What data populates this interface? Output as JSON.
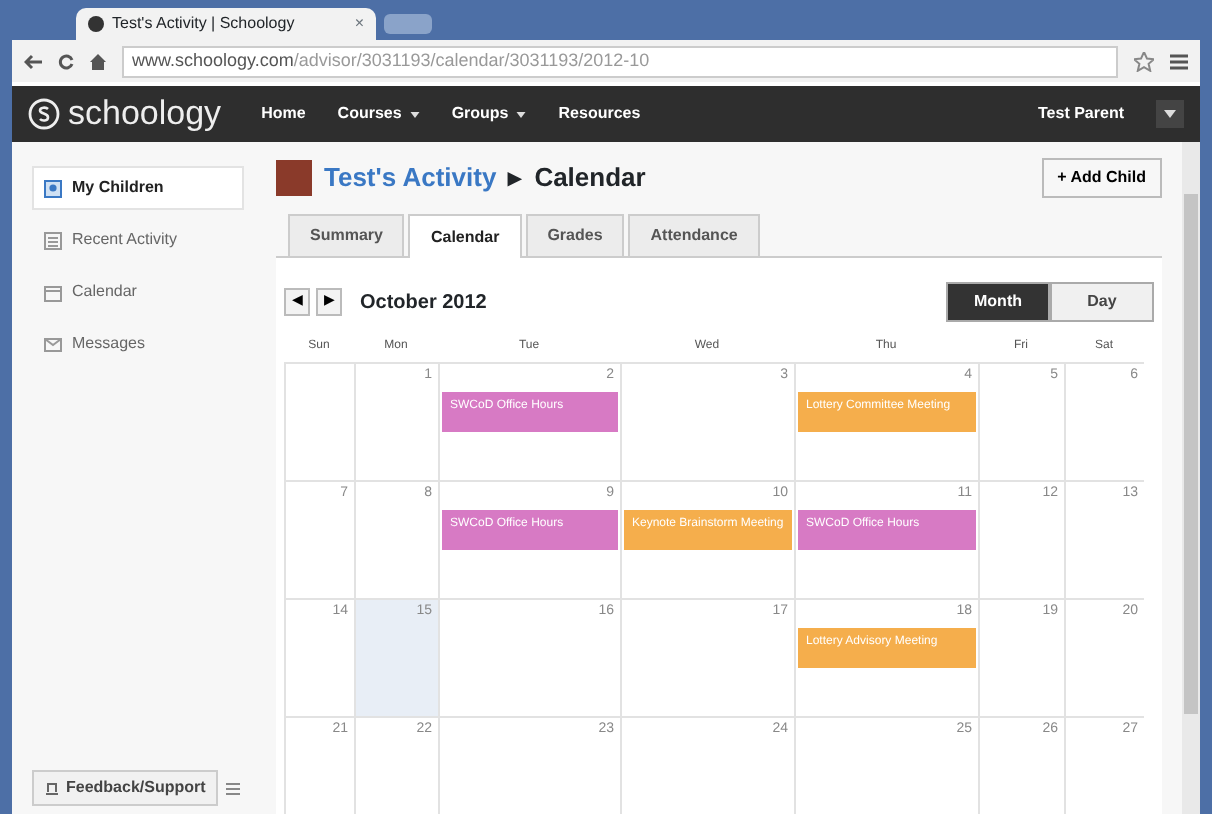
{
  "browser": {
    "tab_title": "Test's Activity | Schoology",
    "tab_close": "×",
    "url_host": "www.schoology.com",
    "url_path": "/advisor/3031193/calendar/3031193/2012-10"
  },
  "navbar": {
    "logo": "schoology",
    "items": [
      {
        "label": "Home",
        "dropdown": false
      },
      {
        "label": "Courses",
        "dropdown": true
      },
      {
        "label": "Groups",
        "dropdown": true
      },
      {
        "label": "Resources",
        "dropdown": false
      }
    ],
    "user": "Test Parent"
  },
  "sidebar": {
    "items": [
      {
        "label": "My Children",
        "selected": true
      },
      {
        "label": "Recent Activity",
        "selected": false
      },
      {
        "label": "Calendar",
        "selected": false
      },
      {
        "label": "Messages",
        "selected": false
      }
    ]
  },
  "header": {
    "link": "Test's Activity",
    "separator": "▸",
    "title": "Calendar",
    "add_button": "+ Add Child"
  },
  "tabs": [
    {
      "label": "Summary",
      "selected": false
    },
    {
      "label": "Calendar",
      "selected": true
    },
    {
      "label": "Grades",
      "selected": false
    },
    {
      "label": "Attendance",
      "selected": false
    }
  ],
  "calendar": {
    "prev": "◀",
    "next": "▶",
    "month": "October 2012",
    "views": [
      {
        "label": "Month",
        "selected": true
      },
      {
        "label": "Day",
        "selected": false
      }
    ],
    "weekdays": [
      "Sun",
      "Mon",
      "Tue",
      "Wed",
      "Thu",
      "Fri",
      "Sat"
    ],
    "weeks": [
      {
        "days": [
          {
            "today": false
          },
          {
            "num": "1",
            "today": false
          },
          {
            "num": "2",
            "today": false,
            "events": [
              {
                "title": "SWCoD Office Hours",
                "color": "#d77ac4"
              }
            ]
          },
          {
            "num": "3",
            "today": false
          },
          {
            "num": "4",
            "today": false,
            "events": [
              {
                "title": "Lottery Committee Meeting",
                "color": "#f5ae4c"
              }
            ]
          },
          {
            "num": "5",
            "today": false
          },
          {
            "num": "6",
            "today": false
          }
        ]
      },
      {
        "days": [
          {
            "num": "7",
            "today": false
          },
          {
            "num": "8",
            "today": false
          },
          {
            "num": "9",
            "today": false,
            "events": [
              {
                "title": "SWCoD Office Hours",
                "color": "#d77ac4"
              }
            ]
          },
          {
            "num": "10",
            "today": false,
            "events": [
              {
                "title": "Keynote Brainstorm Meeting",
                "color": "#f5ae4c"
              }
            ]
          },
          {
            "num": "11",
            "today": false,
            "events": [
              {
                "title": "SWCoD Office Hours",
                "color": "#d77ac4"
              }
            ]
          },
          {
            "num": "12",
            "today": false
          },
          {
            "num": "13",
            "today": false
          }
        ]
      },
      {
        "days": [
          {
            "num": "14",
            "today": false
          },
          {
            "num": "15",
            "today": true
          },
          {
            "num": "16",
            "today": false
          },
          {
            "num": "17",
            "today": false
          },
          {
            "num": "18",
            "today": false,
            "events": [
              {
                "title": "Lottery Advisory Meeting",
                "color": "#f5ae4c"
              }
            ]
          },
          {
            "num": "19",
            "today": false
          },
          {
            "num": "20",
            "today": false
          }
        ]
      },
      {
        "days": [
          {
            "num": "21",
            "today": false
          },
          {
            "num": "22",
            "today": false
          },
          {
            "num": "23",
            "today": false
          },
          {
            "num": "24",
            "today": false
          },
          {
            "num": "25",
            "today": false
          },
          {
            "num": "26",
            "today": false
          },
          {
            "num": "27",
            "today": false
          }
        ]
      }
    ]
  },
  "footer": {
    "feedback": "Feedback/Support"
  }
}
